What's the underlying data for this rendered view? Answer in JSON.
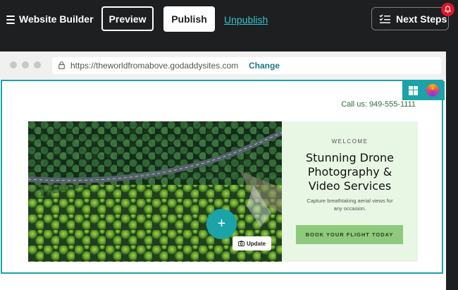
{
  "topbar": {
    "title": "Website Builder",
    "preview_label": "Preview",
    "publish_label": "Publish",
    "unpublish_label": "Unpublish",
    "next_steps_label": "Next Steps"
  },
  "browser": {
    "url": "https://theworldfromabove.godaddysites.com",
    "change_label": "Change"
  },
  "site": {
    "phone": "Call us: 949-555-1111",
    "welcome": "WELCOME",
    "headline_line1": "Stunning Drone",
    "headline_line2": "Photography &",
    "headline_line3": "Video Services",
    "subtext": "Capture breathtaking aerial views for any occasion.",
    "cta_label": "BOOK YOUR FLIGHT TODAY",
    "update_label": "Update"
  },
  "colors": {
    "accent": "#1ba3a8",
    "link": "#37c4cc",
    "cta": "#8fc97d",
    "panel": "#e8f6e4",
    "notification": "#e0162d"
  },
  "icons": [
    "menu-icon",
    "checklist-icon",
    "bell-icon",
    "lock-icon",
    "layout-icon",
    "theme-color-icon",
    "camera-icon",
    "plus-icon"
  ]
}
